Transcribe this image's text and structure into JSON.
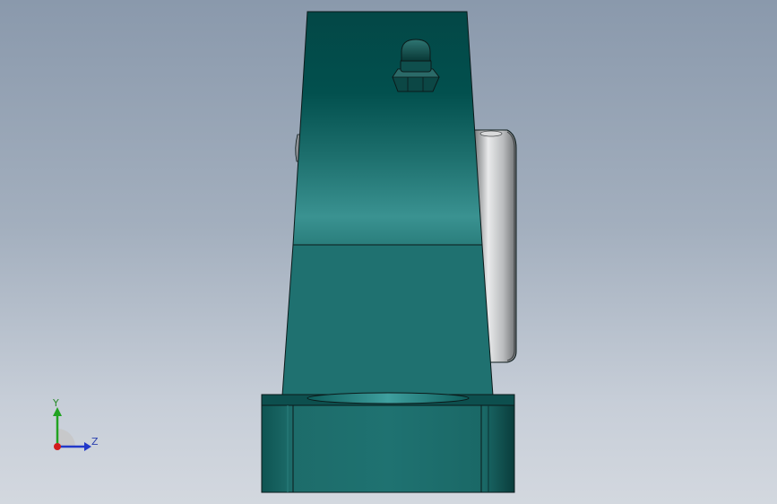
{
  "viewport": {
    "background_top": "#8a99ac",
    "background_bottom": "#d3d8df"
  },
  "part": {
    "body_color": "#1f6f6c",
    "body_dark": "#0a4442",
    "body_highlight": "#3a9190",
    "insert_color": "#b9bbbd",
    "edge_color": "#0b1a1a"
  },
  "triad": {
    "y_label": "Y",
    "z_label": "Z",
    "y_color": "#21a321",
    "z_color": "#2238c9",
    "x_color": "#d21c1c"
  }
}
